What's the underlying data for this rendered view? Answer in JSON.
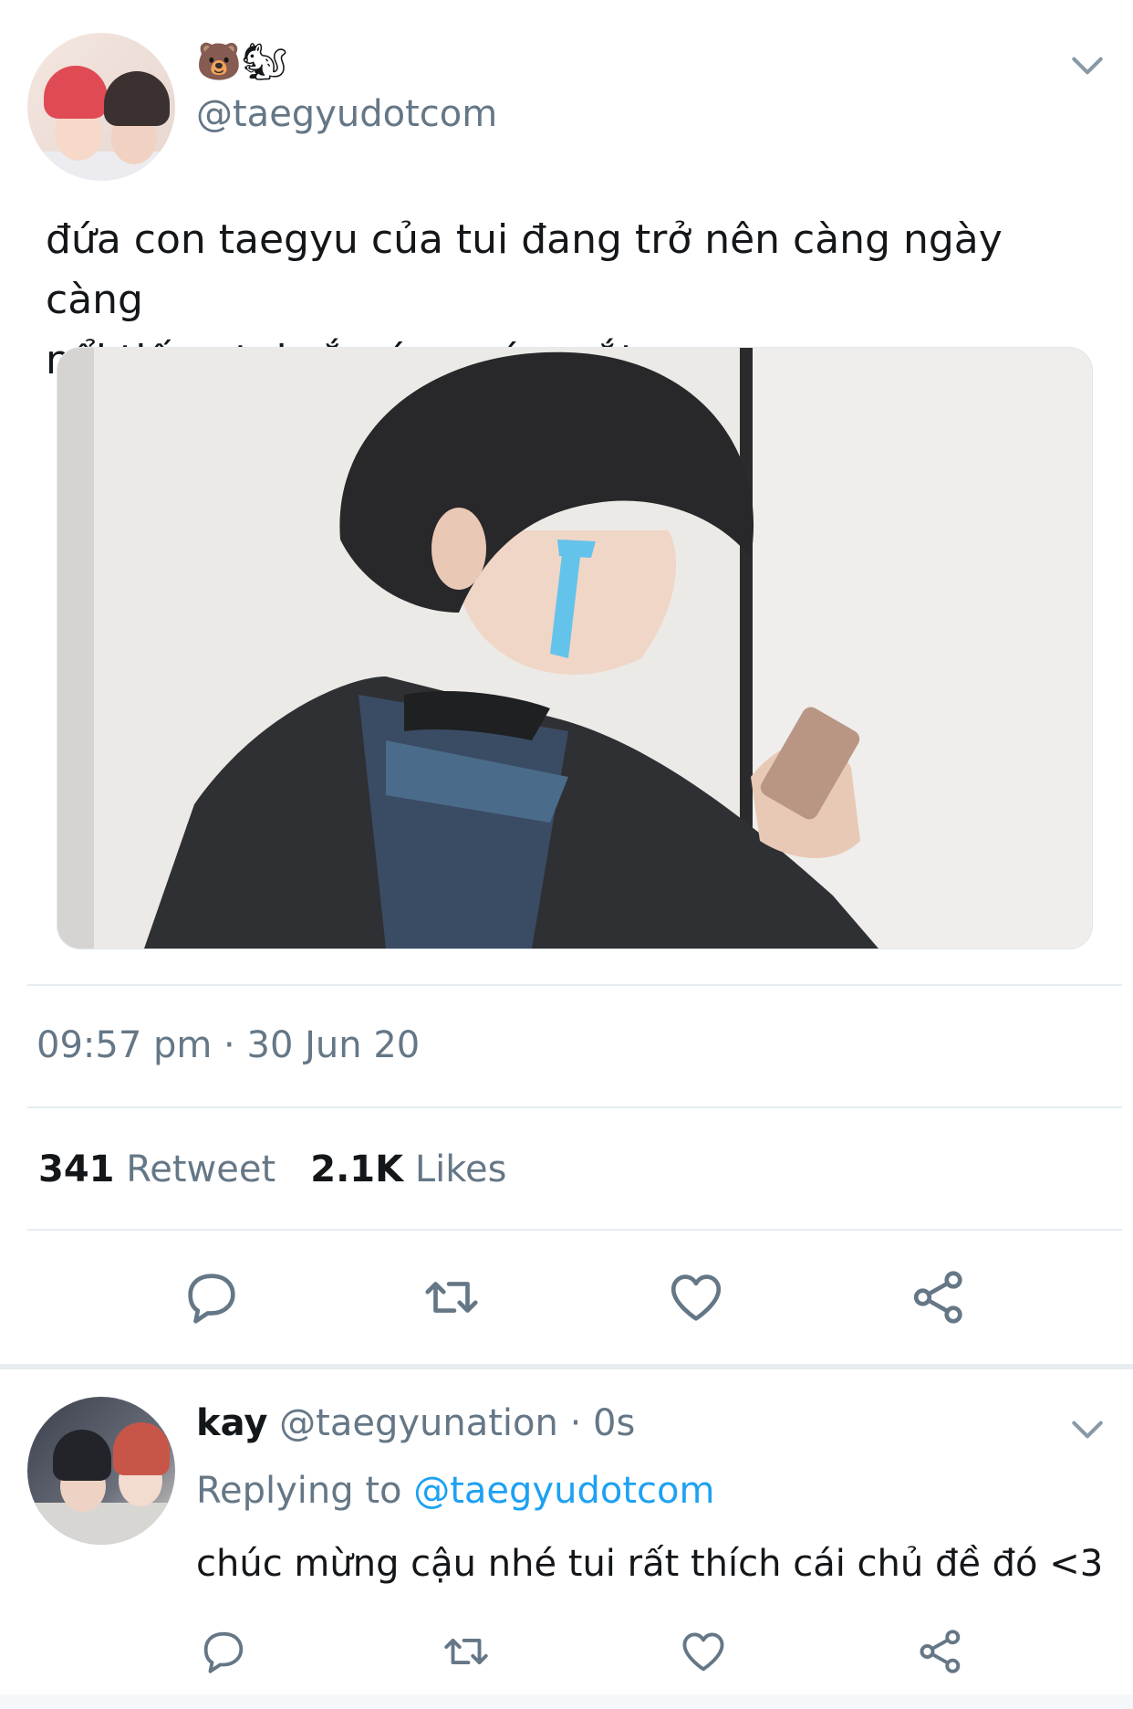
{
  "tweet": {
    "emoji_name": "🐻🐿",
    "handle": "@taegyudotcom",
    "text_line1": "đứa con taegyu của tui đang trở nên càng ngày càng",
    "text_line2": "nổi tiếng tui sắp ứa nước mắt",
    "timestamp": "09:57 pm · 30 Jun 20",
    "retweet_count": "341",
    "retweet_label": "Retweet",
    "like_count": "2.1K",
    "like_label": "Likes"
  },
  "reply": {
    "name": "kay",
    "handle_time": "@taegyunation · 0s",
    "replying_prefix": "Replying to",
    "replying_handle": "@taegyudotcom",
    "text": "chúc mừng cậu nhé tui rất thích cái chủ đề đó <3"
  },
  "icons": {
    "menu": "chevron-down-icon",
    "actions": [
      "reply-icon",
      "retweet-icon",
      "like-icon",
      "share-icon"
    ]
  },
  "colors": {
    "accent": "#1da1f2",
    "secondary_text": "#657786",
    "primary_text": "#14171a",
    "divider": "#e6ecf0"
  }
}
